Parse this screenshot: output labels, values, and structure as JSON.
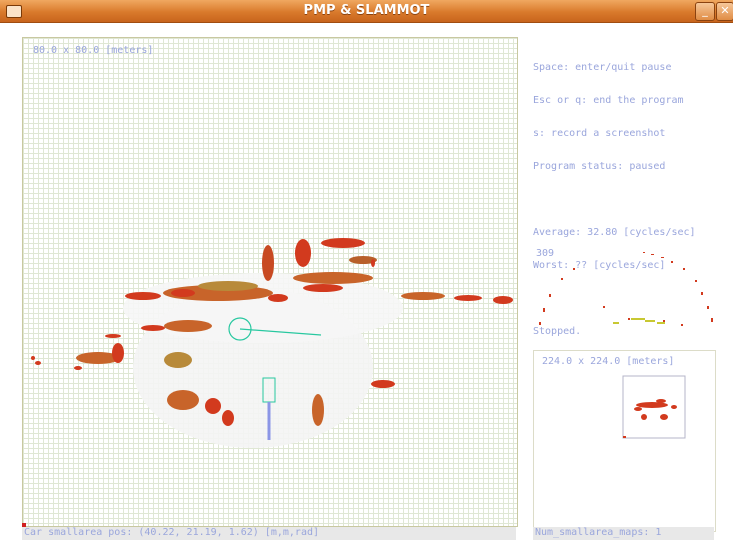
{
  "window": {
    "title": "PMP & SLAMMOT",
    "minimize_glyph": "_",
    "close_glyph": "✕"
  },
  "main_map": {
    "scale_label": "80.0 x 80.0 [meters]"
  },
  "status_bar": {
    "text": "Car smallarea pos: (40.22, 21.19, 1.62) [m,m,rad]"
  },
  "info": {
    "line1": "Space: enter/quit pause",
    "line2": "Esc or q: end the program",
    "line3": "s: record a screenshot",
    "line4": "Program status: paused",
    "average": "Average: 32.80 [cycles/sec]",
    "worst": "Worst: ?? [cycles/sec]",
    "state": "Stopped."
  },
  "scan": {
    "count": "309"
  },
  "overview": {
    "scale_label": "224.0 x 224.0 [meters]",
    "status": "Num_smallarea_maps: 1"
  },
  "colors": {
    "title_bar": "#d97a2c",
    "text": "#9aa6dc",
    "obstacle": "#d23a1e",
    "obstacle_dark": "#8c4a1e",
    "trajectory": "#8c96e6",
    "target": "#28c8a0"
  }
}
